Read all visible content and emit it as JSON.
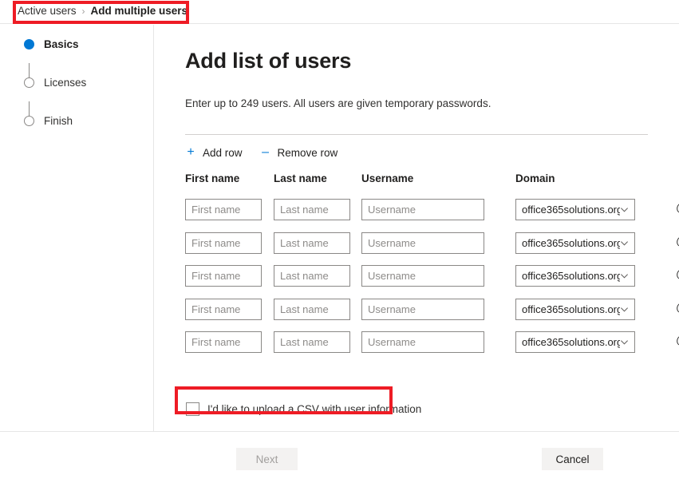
{
  "breadcrumb": {
    "parent": "Active users",
    "separator": "›",
    "current": "Add multiple users"
  },
  "steps": {
    "items": [
      {
        "label": "Basics",
        "state": "active"
      },
      {
        "label": "Licenses",
        "state": "inactive"
      },
      {
        "label": "Finish",
        "state": "inactive"
      }
    ]
  },
  "main": {
    "title": "Add list of users",
    "subtitle": "Enter up to 249 users. All users are given temporary passwords.",
    "commands": {
      "add_row_glyph": "+",
      "add_row_label": "Add row",
      "remove_row_glyph": "–",
      "remove_row_label": "Remove row"
    },
    "columns": {
      "first_name": "First name",
      "last_name": "Last name",
      "username": "Username",
      "domain": "Domain"
    },
    "at_symbol": "@",
    "rows": [
      {
        "first_name_value": "",
        "first_name_placeholder": "First name",
        "last_name_value": "",
        "last_name_placeholder": "Last name",
        "username_value": "",
        "username_placeholder": "Username",
        "domain_value": "office365solutions.org"
      },
      {
        "first_name_value": "",
        "first_name_placeholder": "First name",
        "last_name_value": "",
        "last_name_placeholder": "Last name",
        "username_value": "",
        "username_placeholder": "Username",
        "domain_value": "office365solutions.org"
      },
      {
        "first_name_value": "",
        "first_name_placeholder": "First name",
        "last_name_value": "",
        "last_name_placeholder": "Last name",
        "username_value": "",
        "username_placeholder": "Username",
        "domain_value": "office365solutions.org"
      },
      {
        "first_name_value": "",
        "first_name_placeholder": "First name",
        "last_name_value": "",
        "last_name_placeholder": "Last name",
        "username_value": "",
        "username_placeholder": "Username",
        "domain_value": "office365solutions.org"
      },
      {
        "first_name_value": "",
        "first_name_placeholder": "First name",
        "last_name_value": "",
        "last_name_placeholder": "Last name",
        "username_value": "",
        "username_placeholder": "Username",
        "domain_value": "office365solutions.org"
      }
    ],
    "csv_checkbox": {
      "label": "I'd like to upload a CSV with user information",
      "checked": false
    }
  },
  "footer": {
    "next_label": "Next",
    "next_disabled": true,
    "cancel_label": "Cancel"
  },
  "colors": {
    "accent": "#0078d4",
    "annotation": "#ee1c25",
    "text": "#323130",
    "border": "#8a8886",
    "button_bg": "#f3f2f1"
  }
}
